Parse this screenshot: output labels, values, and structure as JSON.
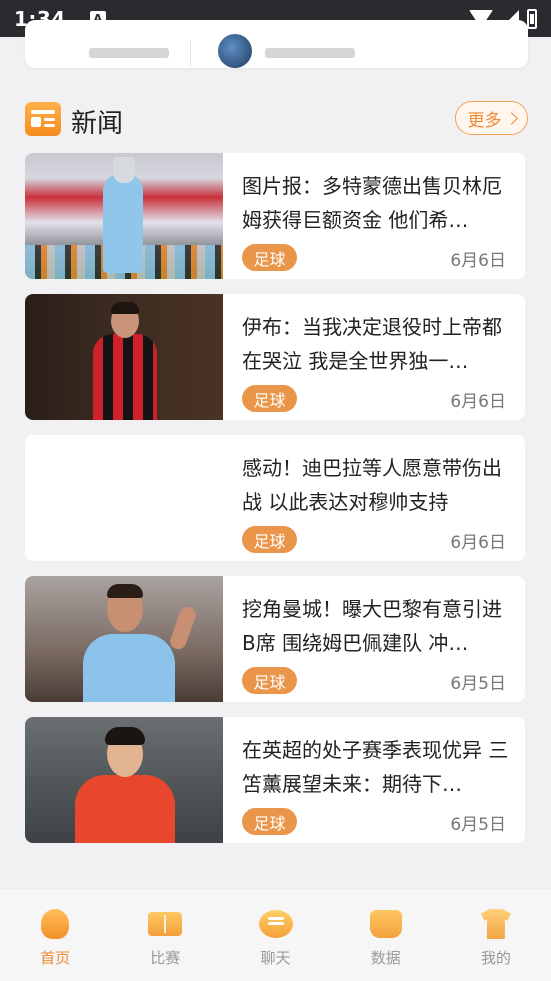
{
  "status_bar": {
    "time": "1:34",
    "notification_icon": "A"
  },
  "section": {
    "title": "新闻",
    "more_label": "更多"
  },
  "news": [
    {
      "title": "图片报：多特蒙德出售贝林厄姆获得巨额资金 他们希…",
      "tag": "足球",
      "date": "6月6日"
    },
    {
      "title": "伊布：当我决定退役时上帝都在哭泣 我是全世界独一…",
      "tag": "足球",
      "date": "6月6日"
    },
    {
      "title": "感动！迪巴拉等人愿意带伤出战 以此表达对穆帅支持",
      "tag": "足球",
      "date": "6月6日"
    },
    {
      "title": "挖角曼城！曝大巴黎有意引进B席 围绕姆巴佩建队 冲…",
      "tag": "足球",
      "date": "6月5日"
    },
    {
      "title": "在英超的处子赛季表现优异 三笘薰展望未来：期待下…",
      "tag": "足球",
      "date": "6月5日"
    }
  ],
  "bottom_nav": [
    {
      "label": "首页",
      "icon": "home-icon",
      "active": true
    },
    {
      "label": "比赛",
      "icon": "match-icon",
      "active": false
    },
    {
      "label": "聊天",
      "icon": "chat-icon",
      "active": false
    },
    {
      "label": "数据",
      "icon": "data-icon",
      "active": false
    },
    {
      "label": "我的",
      "icon": "profile-icon",
      "active": false
    }
  ],
  "colors": {
    "accent": "#f08a32",
    "tag_bg": "#e9964b",
    "status_bar_bg": "#2b2b2f"
  }
}
